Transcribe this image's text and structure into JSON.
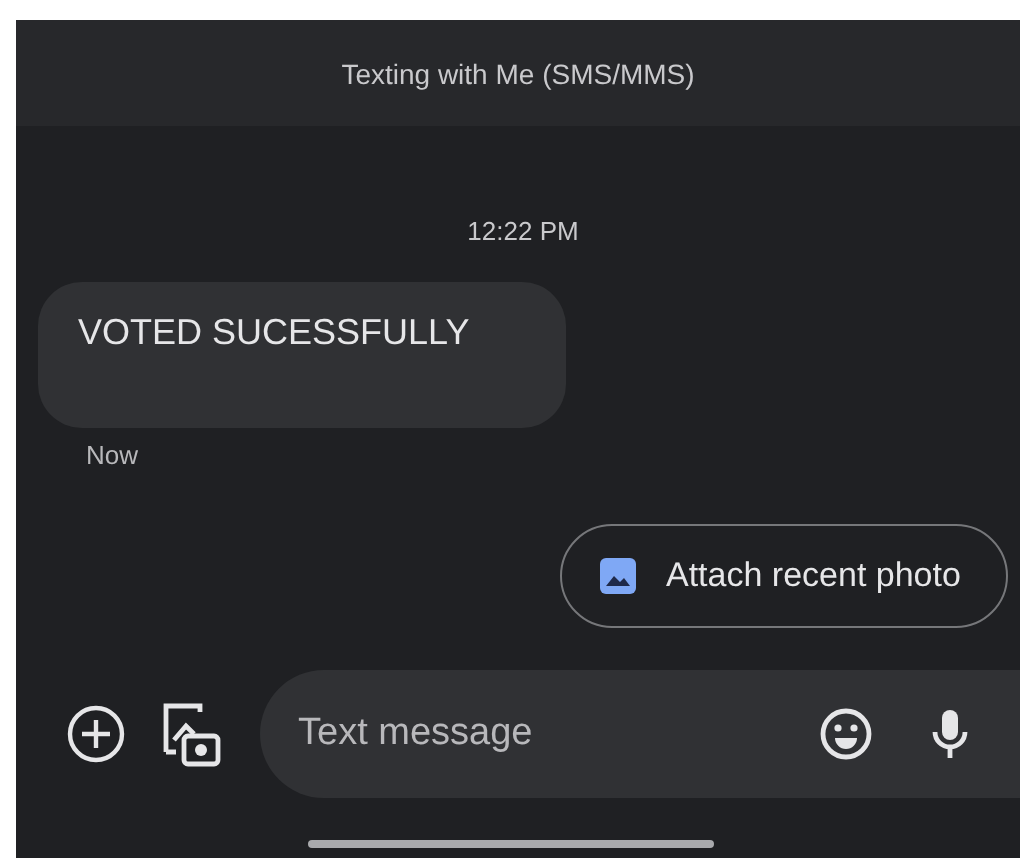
{
  "header": {
    "title": "Texting with Me (SMS/MMS)"
  },
  "timestamp": "12:22 PM",
  "messages": [
    {
      "text": "VOTED SUCESSFULLY",
      "time": "Now"
    }
  ],
  "suggestion": {
    "label": "Attach recent photo"
  },
  "composer": {
    "placeholder": "Text message"
  }
}
